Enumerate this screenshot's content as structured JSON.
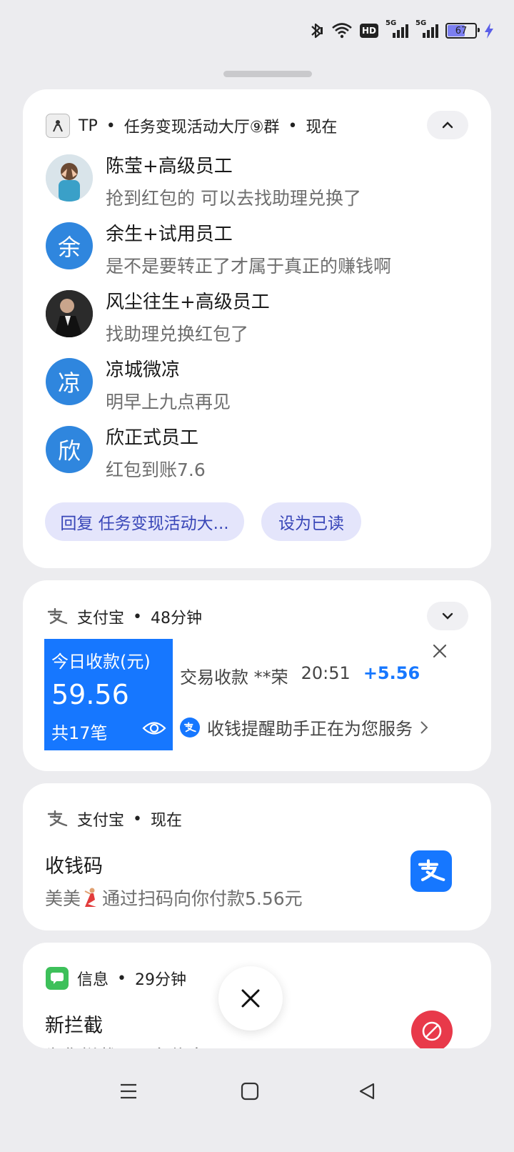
{
  "status_bar": {
    "icons": [
      "bluetooth-icon",
      "wifi-icon",
      "hd-icon",
      "signal-5g-icon",
      "signal-5g-icon"
    ],
    "hd_label": "HD",
    "network_label_1": "5G",
    "network_label_2": "5G",
    "battery_level": "67",
    "battery_fraction": 0.67,
    "charging": true
  },
  "group_notification": {
    "app_name": "TP",
    "separator1": "•",
    "group": "任务变现活动大厅⑨群",
    "separator2": "•",
    "time": "现在",
    "messages": [
      {
        "name": "陈莹+高级员工",
        "text": "抢到红包的   可以去找助理兑换了",
        "avatar": "photo"
      },
      {
        "name": "余生+试用员工",
        "text": "是不是要转正了才属于真正的赚钱啊",
        "avatar": "余"
      },
      {
        "name": "风尘往生+高级员工",
        "text": "找助理兑换红包了",
        "avatar": "photo"
      },
      {
        "name": "凉城微凉",
        "text": "明早上九点再见",
        "avatar": "凉"
      },
      {
        "name": "欣正式员工",
        "text": "红包到账7.6",
        "avatar": "欣"
      }
    ],
    "reply_button": "回复 任务变现活动大...",
    "mark_read_button": "设为已读"
  },
  "alipay_card": {
    "app_name": "支付宝",
    "separator": "•",
    "time": "48分钟",
    "tile_title": "今日收款(元)",
    "tile_amount": "59.56",
    "tile_count": "共17笔",
    "transaction_label": "交易收款 **荣",
    "transaction_time": "20:51",
    "transaction_amount": "+5.56",
    "assistant_text": "收钱提醒助手正在为您服务",
    "accent_color": "#1677ff"
  },
  "alipay_qr_card": {
    "app_name": "支付宝",
    "separator": "•",
    "time": "现在",
    "title": "收钱码",
    "text_before": "美美",
    "text_after": "通过扫码向你付款5.56元"
  },
  "sms_card": {
    "app_name": "信息",
    "separator": "•",
    "time": "29分钟",
    "title": "新拦截",
    "text": "为您拦截了一条信息"
  },
  "nav_bar": {
    "items": [
      "menu-icon",
      "home-icon",
      "back-icon"
    ]
  }
}
